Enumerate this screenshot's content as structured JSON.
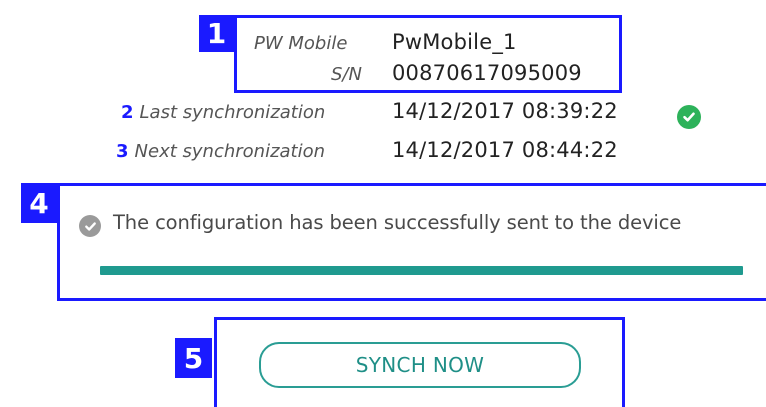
{
  "device": {
    "callout": "1",
    "model_label": "PW Mobile",
    "model_value": "PwMobile_1",
    "serial_label": "S/N",
    "serial_value": "00870617095009"
  },
  "last_sync": {
    "callout": "2",
    "label": "Last synchronization",
    "value": "14/12/2017 08:39:22",
    "status_icon": "check-circle-icon",
    "status_color": "#2db25a"
  },
  "next_sync": {
    "callout": "3",
    "label": "Next synchronization",
    "value": "14/12/2017 08:44:22"
  },
  "notification": {
    "callout": "4",
    "icon": "check-circle-icon",
    "message": "The configuration has been successfully sent to the device",
    "progress": 1.0,
    "progress_color": "#1f9a8f"
  },
  "sync": {
    "callout": "5",
    "button_label": "SYNCH NOW"
  },
  "colors": {
    "callout": "#1a1aff",
    "accent": "#2a9d94"
  }
}
